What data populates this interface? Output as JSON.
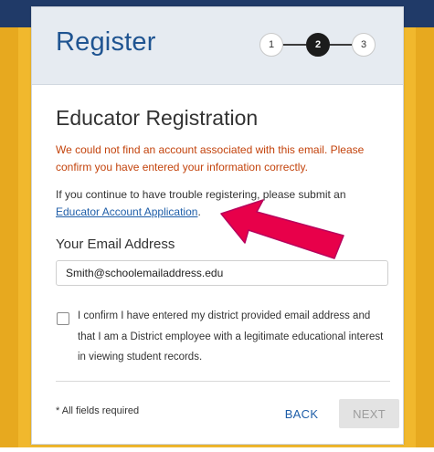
{
  "header": {
    "title": "Register",
    "steps": [
      "1",
      "2",
      "3"
    ],
    "active_step": 2
  },
  "form": {
    "heading": "Educator Registration",
    "error_message": "We could not find an account associated with this email. Please confirm you have entered your information correctly.",
    "help_text": "If you continue to have trouble registering, please submit an",
    "help_link": "Educator Account Application",
    "help_suffix": ".",
    "email_label": "Your Email Address",
    "email_value": "Smith@schoolemailaddress.edu",
    "confirm_text": "I confirm I have entered my district provided email address and that I am a District employee with a legitimate educational interest in viewing student records.",
    "confirm_checked": false,
    "required_note": "* All fields required",
    "back_label": "BACK",
    "next_label": "NEXT"
  },
  "colors": {
    "brand_blue": "#1f5491",
    "error_orange": "#c3430c",
    "link_blue": "#1f5ea8",
    "background_gold": "#f1b82d",
    "background_navy": "#203a68",
    "annotation_arrow": "#e8004a"
  },
  "icons": [
    "checkbox-icon",
    "annotation-arrow-icon"
  ]
}
